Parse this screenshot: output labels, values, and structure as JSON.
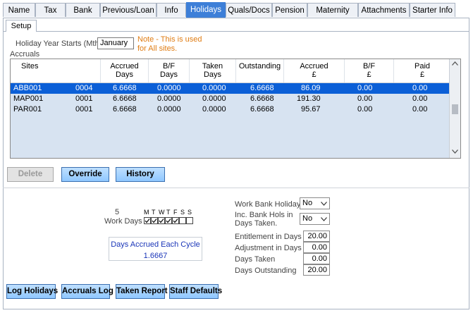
{
  "tabs": [
    {
      "label": "Name",
      "active": false
    },
    {
      "label": "Tax",
      "active": false
    },
    {
      "label": "Bank",
      "active": false
    },
    {
      "label": "Previous/Loan",
      "active": false
    },
    {
      "label": "Info",
      "active": false
    },
    {
      "label": "Holidays",
      "active": true
    },
    {
      "label": "Quals/Docs",
      "active": false
    },
    {
      "label": "Pension",
      "active": false
    },
    {
      "label": "Maternity Pay",
      "active": false
    },
    {
      "label": "Attachments",
      "active": false
    },
    {
      "label": "Starter Info",
      "active": false
    }
  ],
  "subtab": {
    "label": "Setup"
  },
  "holiday_year": {
    "label": "Holiday Year Starts (Mth)",
    "value": "January",
    "note_line1": "Note - This is used",
    "note_line2": "for All sites."
  },
  "accruals": {
    "section_label": "Accruals",
    "columns": [
      {
        "line1": "Sites",
        "line2": ""
      },
      {
        "line1": "Accrued",
        "line2": "Days"
      },
      {
        "line1": "B/F",
        "line2": "Days"
      },
      {
        "line1": "Taken",
        "line2": "Days"
      },
      {
        "line1": "Outstanding",
        "line2": ""
      },
      {
        "line1": "Accrued",
        "line2": "£"
      },
      {
        "line1": "B/F",
        "line2": "£"
      },
      {
        "line1": "Paid",
        "line2": "£"
      }
    ],
    "rows": [
      {
        "site": "ABB001",
        "code": "0004",
        "accrued_days": "6.6668",
        "bf_days": "0.0000",
        "taken_days": "0.0000",
        "outstanding": "6.6668",
        "accrued_amt": "86.09",
        "bf_amt": "0.00",
        "paid_amt": "0.00",
        "selected": true
      },
      {
        "site": "MAP001",
        "code": "0001",
        "accrued_days": "6.6668",
        "bf_days": "0.0000",
        "taken_days": "0.0000",
        "outstanding": "6.6668",
        "accrued_amt": "191.30",
        "bf_amt": "0.00",
        "paid_amt": "0.00",
        "selected": false
      },
      {
        "site": "PAR001",
        "code": "0001",
        "accrued_days": "6.6668",
        "bf_days": "0.0000",
        "taken_days": "0.0000",
        "outstanding": "6.6668",
        "accrued_amt": "95.67",
        "bf_amt": "0.00",
        "paid_amt": "0.00",
        "selected": false
      }
    ]
  },
  "buttons": {
    "delete": "Delete",
    "override": "Override",
    "history": "History",
    "log_holidays": "Log Holidays",
    "accruals_log": "Accruals Log",
    "taken_report": "Taken Report",
    "staff_defaults": "Staff Defaults"
  },
  "work_days": {
    "count": "5",
    "label": "Work Days",
    "day_letters": [
      "M",
      "T",
      "W",
      "T",
      "F",
      "S",
      "S"
    ],
    "checked": [
      true,
      true,
      true,
      true,
      true,
      false,
      false
    ]
  },
  "cycle": {
    "label": "Days Accrued Each Cycle",
    "value": "1.6667"
  },
  "settings": {
    "work_bank_holidays_label": "Work Bank Holidays",
    "work_bank_holidays_value": "No",
    "inc_bank_hols_line1": "Inc. Bank Hols in",
    "inc_bank_hols_line2": "Days Taken.",
    "inc_bank_hols_value": "No",
    "entitlement_label": "Entitlement in Days",
    "entitlement_value": "20.00",
    "adjustment_label": "Adjustment in Days",
    "adjustment_value": "0.00",
    "days_taken_label": "Days Taken",
    "days_taken_value": "0.00",
    "days_outstanding_label": "Days Outstanding",
    "days_outstanding_value": "20.00"
  }
}
